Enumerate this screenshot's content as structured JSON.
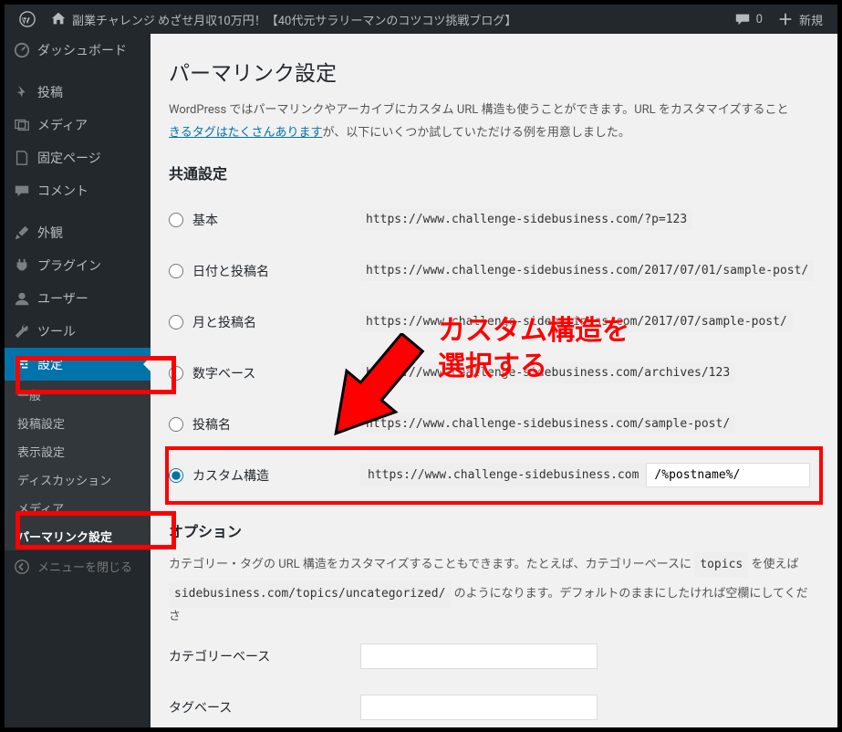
{
  "adminbar": {
    "site_title": "副業チャレンジ めざせ月収10万円！【40代元サラリーマンのコツコツ挑戦ブログ】",
    "comments_count": "0",
    "new_label": "新規"
  },
  "sidebar": {
    "dashboard": "ダッシュボード",
    "posts": "投稿",
    "media": "メディア",
    "pages": "固定ページ",
    "comments": "コメント",
    "appearance": "外観",
    "plugins": "プラグイン",
    "users": "ユーザー",
    "tools": "ツール",
    "settings": "設定",
    "sub": {
      "general": "一般",
      "writing": "投稿設定",
      "reading": "表示設定",
      "discussion": "ディスカッション",
      "media": "メディア",
      "permalink": "パーマリンク設定"
    },
    "collapse": "メニューを閉じる"
  },
  "page": {
    "title": "パーマリンク設定",
    "desc_1": "WordPress ではパーマリンクやアーカイブにカスタム URL 構造も使うことができます。URL をカスタマイズすること",
    "desc_link": "きるタグはたくさんあります",
    "desc_2": "が、以下にいくつか試していただける例を用意しました。",
    "common_heading": "共通設定",
    "options": {
      "default": {
        "label": "基本",
        "code": "https://www.challenge-sidebusiness.com/?p=123"
      },
      "day_name": {
        "label": "日付と投稿名",
        "code": "https://www.challenge-sidebusiness.com/2017/07/01/sample-post/"
      },
      "month_name": {
        "label": "月と投稿名",
        "code": "https://www.challenge-sidebusiness.com/2017/07/sample-post/"
      },
      "numeric": {
        "label": "数字ベース",
        "code": "https://www.challenge-sidebusiness.com/archives/123"
      },
      "postname": {
        "label": "投稿名",
        "code": "https://www.challenge-sidebusiness.com/sample-post/"
      },
      "custom": {
        "label": "カスタム構造",
        "prefix": "https://www.challenge-sidebusiness.com",
        "value": "/%postname%/"
      }
    },
    "option_heading": "オプション",
    "option_desc_a": "カテゴリー・タグの URL 構造をカスタマイズすることもできます。たとえば、カテゴリーベースに ",
    "option_topics": "topics",
    "option_desc_b": " を使えば",
    "option_code": "sidebusiness.com/topics/uncategorized/",
    "option_desc_c": " のようになります。デフォルトのままにしたければ空欄にしてくださ",
    "category_base": "カテゴリーベース",
    "tag_base": "タグベース"
  },
  "annotation": {
    "text1": "カスタム構造を",
    "text2": "選択する"
  },
  "colors": {
    "accent": "#0073aa",
    "highlight": "#ff0000"
  }
}
